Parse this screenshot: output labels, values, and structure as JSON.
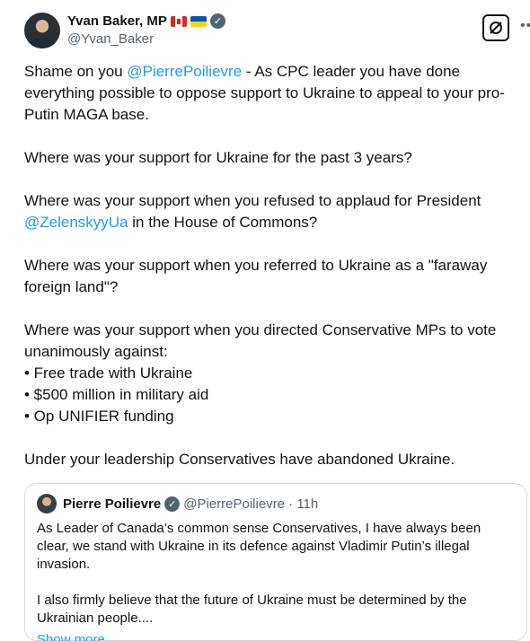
{
  "author": {
    "name": "Yvan Baker, MP",
    "handle": "@Yvan_Baker",
    "flags": [
      "canada-flag",
      "ukraine-flag"
    ],
    "verified": true
  },
  "tweet": {
    "p1_a": "Shame on you ",
    "p1_mention": "@PierrePoilievre",
    "p1_b": " - As CPC leader you have done everything possible to oppose support to Ukraine to appeal to your pro-Putin MAGA base.",
    "p2": "Where was your support for Ukraine for the past 3 years?",
    "p3_a": "Where was your support when you refused to applaud for President ",
    "p3_mention": "@ZelenskyyUa",
    "p3_b": " in the House of Commons?",
    "p4": "Where was your support when you referred to Ukraine as a \"faraway foreign land\"?",
    "p5": "Where was your support when you directed Conservative MPs to vote unanimously against:",
    "bullets": [
      "• Free trade with Ukraine",
      "• $500 million in military aid",
      "• Op UNIFIER funding"
    ],
    "p6": "Under your leadership Conservatives have abandoned Ukraine."
  },
  "quoted": {
    "name": "Pierre Poilievre",
    "meta": "@PierrePoilievre · 11h",
    "p1": "As Leader of Canada’s common sense Conservatives, I have always been clear, we stand with Ukraine in its defence against Vladimir Putin’s illegal invasion.",
    "p2": "I also firmly believe that the future of Ukraine must be determined by the Ukrainian people....",
    "show_more": "Show more"
  },
  "colors": {
    "accent": "#1d9bf0",
    "muted": "#536471",
    "border": "#cfd9de"
  }
}
